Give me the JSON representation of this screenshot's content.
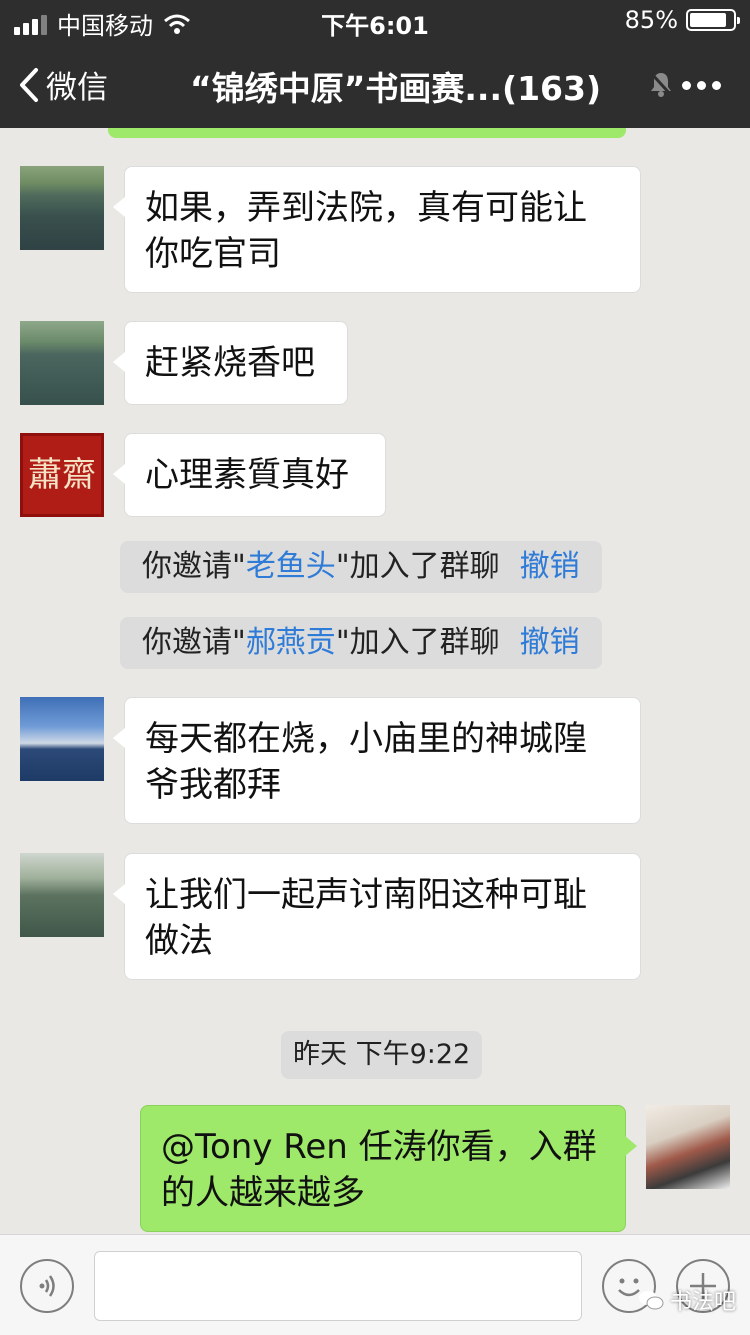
{
  "status_bar": {
    "carrier": "中国移动",
    "time": "下午6:01",
    "battery": "85%",
    "battery_level": 0.85
  },
  "nav": {
    "back_label": "微信",
    "title": "“锦绣中原”书画赛...(163)"
  },
  "messages": [
    {
      "side": "left",
      "avatar": "river-avatar",
      "text": "如果，弄到法院，真有可能让你吃官司"
    },
    {
      "side": "left",
      "avatar": "river-avatar",
      "text": "赶紧烧香吧"
    },
    {
      "side": "left",
      "avatar": "seal-avatar",
      "seal_text": "蕭齋",
      "text": "心理素質真好"
    },
    {
      "side": "left",
      "avatar": "sky-avatar",
      "text": "每天都在烧，小庙里的神城隍爷我都拜"
    },
    {
      "side": "left",
      "avatar": "reed-avatar",
      "text": "让我们一起声讨南阳这种可耻做法"
    },
    {
      "side": "right",
      "avatar": "self-avatar",
      "text": "@Tony Ren 任涛你看，入群的人越来越多"
    }
  ],
  "system_notices": [
    {
      "prefix": "你邀请\"",
      "name": "老鱼头",
      "suffix": "\"加入了群聊",
      "action": "撤销"
    },
    {
      "prefix": "你邀请\"",
      "name": "郝燕贡",
      "suffix": "\"加入了群聊",
      "action": "撤销"
    }
  ],
  "timestamp": "昨天 下午9:22",
  "input": {
    "placeholder": "",
    "voice_icon": "voice-icon",
    "emoji_icon": "emoji-icon",
    "plus_icon": "plus-icon"
  },
  "watermark": "书法吧"
}
